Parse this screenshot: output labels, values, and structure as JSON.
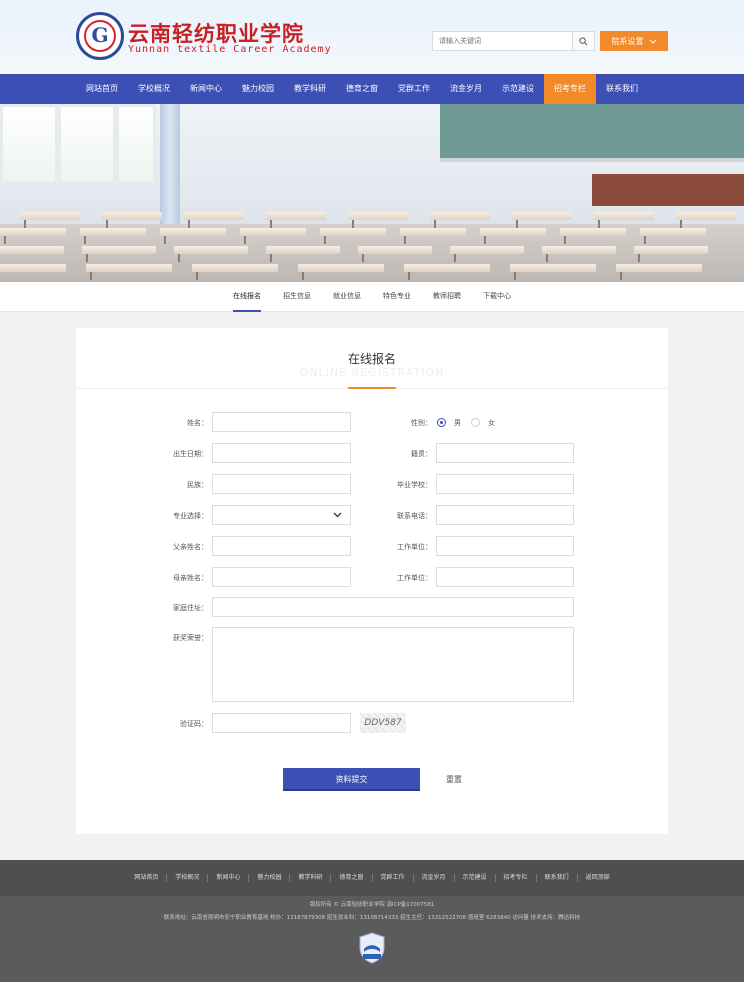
{
  "header": {
    "logo_letter": "G",
    "school_name_cn": "云南轻纺职业学院",
    "school_name_en": "Yunnan textile Career Academy",
    "search_placeholder": "请输入关键词",
    "dept_button": "院系设置"
  },
  "nav": {
    "items": [
      "网站首页",
      "学校概况",
      "新闻中心",
      "魅力校园",
      "教学科研",
      "德育之窗",
      "党群工作",
      "流金岁月",
      "示范建设",
      "招考专栏",
      "联系我们"
    ],
    "active": "招考专栏"
  },
  "subnav": {
    "items": [
      "在线报名",
      "招生信息",
      "就业信息",
      "特色专业",
      "教师招聘",
      "下载中心"
    ],
    "active": "在线报名"
  },
  "form": {
    "title": "在线报名",
    "title_en": "ONLINE REGISTRATION",
    "name_label": "姓名：",
    "gender_label": "性别：",
    "gender_male": "男",
    "gender_female": "女",
    "gender_selected": "男",
    "birth_label": "出生日期：",
    "native_label": "籍贯：",
    "ethnic_label": "民族：",
    "school_label": "毕业学校：",
    "major_label": "专业选择：",
    "phone_label": "联系电话：",
    "father_label": "父亲姓名：",
    "father_work_label": "工作单位：",
    "mother_label": "母亲姓名：",
    "mother_work_label": "工作单位：",
    "address_label": "家庭住址：",
    "honors_label": "获奖荣誉：",
    "captcha_label": "验证码：",
    "captcha_code": "DDV587",
    "submit": "资料提交",
    "reset": "重置"
  },
  "footer": {
    "links": [
      "网站首页",
      "学校概况",
      "新闻中心",
      "魅力校园",
      "教学科研",
      "德育之窗",
      "党群工作",
      "流金岁月",
      "示范建设",
      "招考专栏",
      "联系我们",
      "返回顶部"
    ],
    "copyright": "版权所有 © 云南轻纺职业学院  滇ICP备17007581",
    "contact": "联系地址：云南省昆明市安宁职业教育基地  校办：13187879308  招生就业科：13108714333  招生主任：13312522706  值班室  6283840  访问量  技术支持：腾达科技",
    "badge_text": "事业单位"
  },
  "colors": {
    "nav_blue": "#3b4fb5",
    "accent_orange": "#f28a2a",
    "brand_red": "#c81f25"
  }
}
